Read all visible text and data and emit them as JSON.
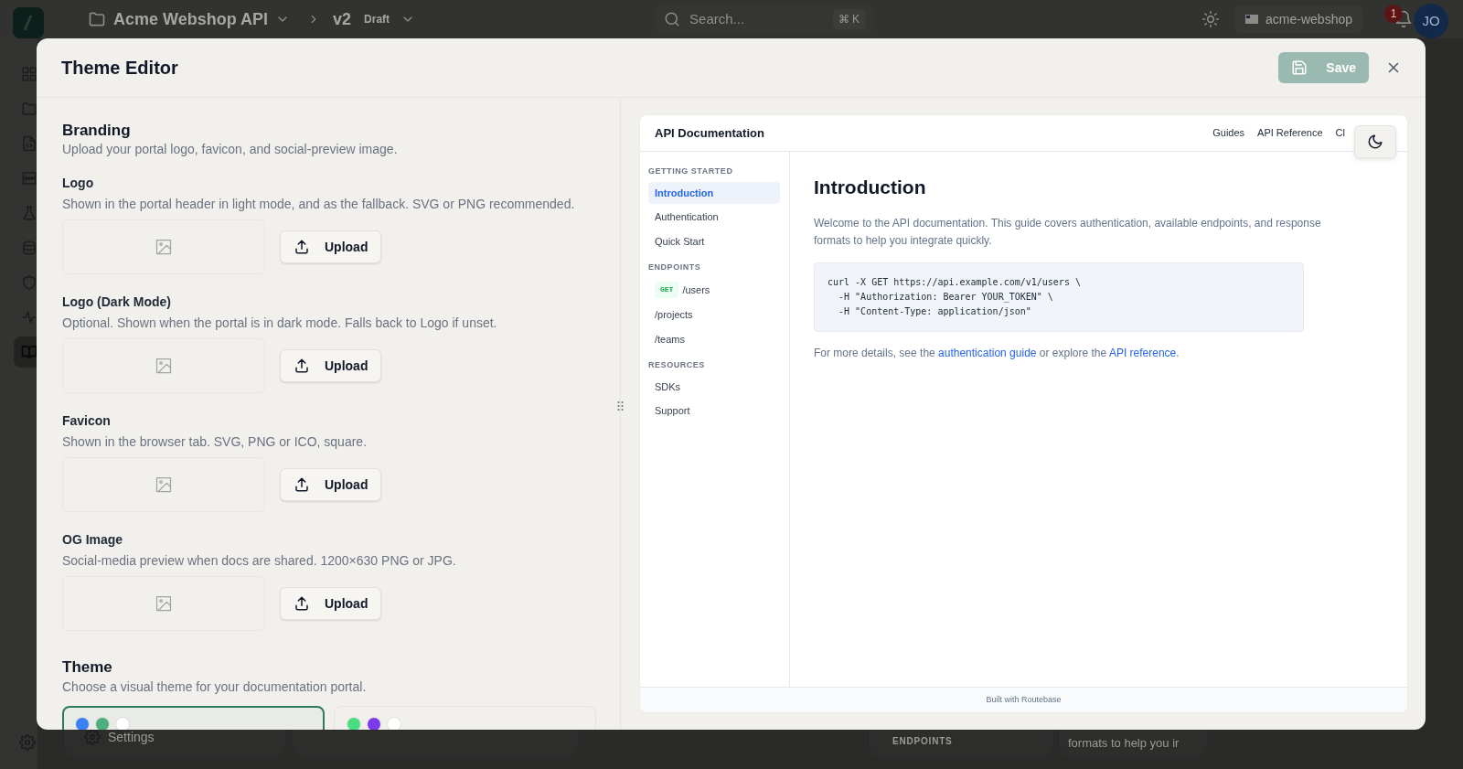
{
  "app": {
    "workspace": "Acme Webshop API",
    "version": "v2",
    "status": "Draft",
    "search": {
      "placeholder": "Search..."
    },
    "shortcut": "⌘ K",
    "org": "acme-webshop",
    "notifications": "1",
    "avatar": "JO",
    "rail": [
      {
        "kind": "grid",
        "selected": false
      },
      {
        "kind": "folder",
        "selected": false
      },
      {
        "kind": "code",
        "selected": false
      },
      {
        "kind": "server",
        "selected": false
      },
      {
        "kind": "flask",
        "selected": false
      },
      {
        "kind": "database",
        "selected": false
      },
      {
        "kind": "shield",
        "selected": false
      },
      {
        "kind": "pulse",
        "selected": false
      },
      {
        "kind": "book",
        "selected": true
      }
    ],
    "background": {
      "settings": "Settings",
      "section_label": "ENDPOINTS",
      "text": "formats to help you ir"
    }
  },
  "modal": {
    "title": "Theme Editor",
    "save": "Save",
    "branding": {
      "title": "Branding",
      "description": "Upload your portal logo, favicon, and social-preview image."
    },
    "uploads": [
      {
        "label": "Logo",
        "description": "Shown in the portal header in light mode, and as the fallback. SVG or PNG recommended.",
        "button": "Upload"
      },
      {
        "label": "Logo (Dark Mode)",
        "description": "Optional. Shown when the portal is in dark mode. Falls back to Logo if unset.",
        "button": "Upload"
      },
      {
        "label": "Favicon",
        "description": "Shown in the browser tab. SVG, PNG or ICO, square.",
        "button": "Upload"
      },
      {
        "label": "OG Image",
        "description": "Social-media preview when docs are shared. 1200×630 PNG or JPG.",
        "button": "Upload"
      }
    ],
    "theme": {
      "title": "Theme",
      "description": "Choose a visual theme for your documentation portal.",
      "options": [
        {
          "selected": true,
          "swatches": [
            {
              "color": "#3b82f6"
            },
            {
              "color": "#4caf7d"
            },
            {
              "color": "#ffffff"
            }
          ]
        },
        {
          "selected": false,
          "swatches": [
            {
              "color": "#4ade80"
            },
            {
              "color": "#7c3aed"
            },
            {
              "color": "#ffffff"
            }
          ]
        }
      ]
    },
    "preview": {
      "title": "API Documentation",
      "nav": [
        "Guides",
        "API Reference",
        "Cl"
      ],
      "sidebar": [
        {
          "title": "GETTING STARTED",
          "items": [
            {
              "label": "Introduction",
              "selected": true
            },
            {
              "label": "Authentication",
              "selected": false
            },
            {
              "label": "Quick Start",
              "selected": false
            }
          ]
        },
        {
          "title": "ENDPOINTS",
          "items": [
            {
              "label": "/users",
              "method": "GET",
              "selected": false
            },
            {
              "label": "/projects",
              "selected": false
            },
            {
              "label": "/teams",
              "selected": false
            }
          ]
        },
        {
          "title": "RESOURCES",
          "items": [
            {
              "label": "SDKs",
              "selected": false
            },
            {
              "label": "Support",
              "selected": false
            }
          ]
        }
      ],
      "heading": "Introduction",
      "intro": "Welcome to the API documentation. This guide covers authentication, available endpoints, and response formats to help you integrate quickly.",
      "code": [
        "curl -X GET https://api.example.com/v1/users \\",
        "  -H \"Authorization: Bearer YOUR_TOKEN\" \\",
        "  -H \"Content-Type: application/json\""
      ],
      "more": [
        {
          "kind": "text",
          "text": "For more details, see the "
        },
        {
          "kind": "link",
          "text": "authentication guide"
        },
        {
          "kind": "text",
          "text": " or explore the "
        },
        {
          "kind": "link",
          "text": "API reference"
        },
        {
          "kind": "text",
          "text": "."
        }
      ],
      "footer": "Built with Routebase"
    }
  }
}
